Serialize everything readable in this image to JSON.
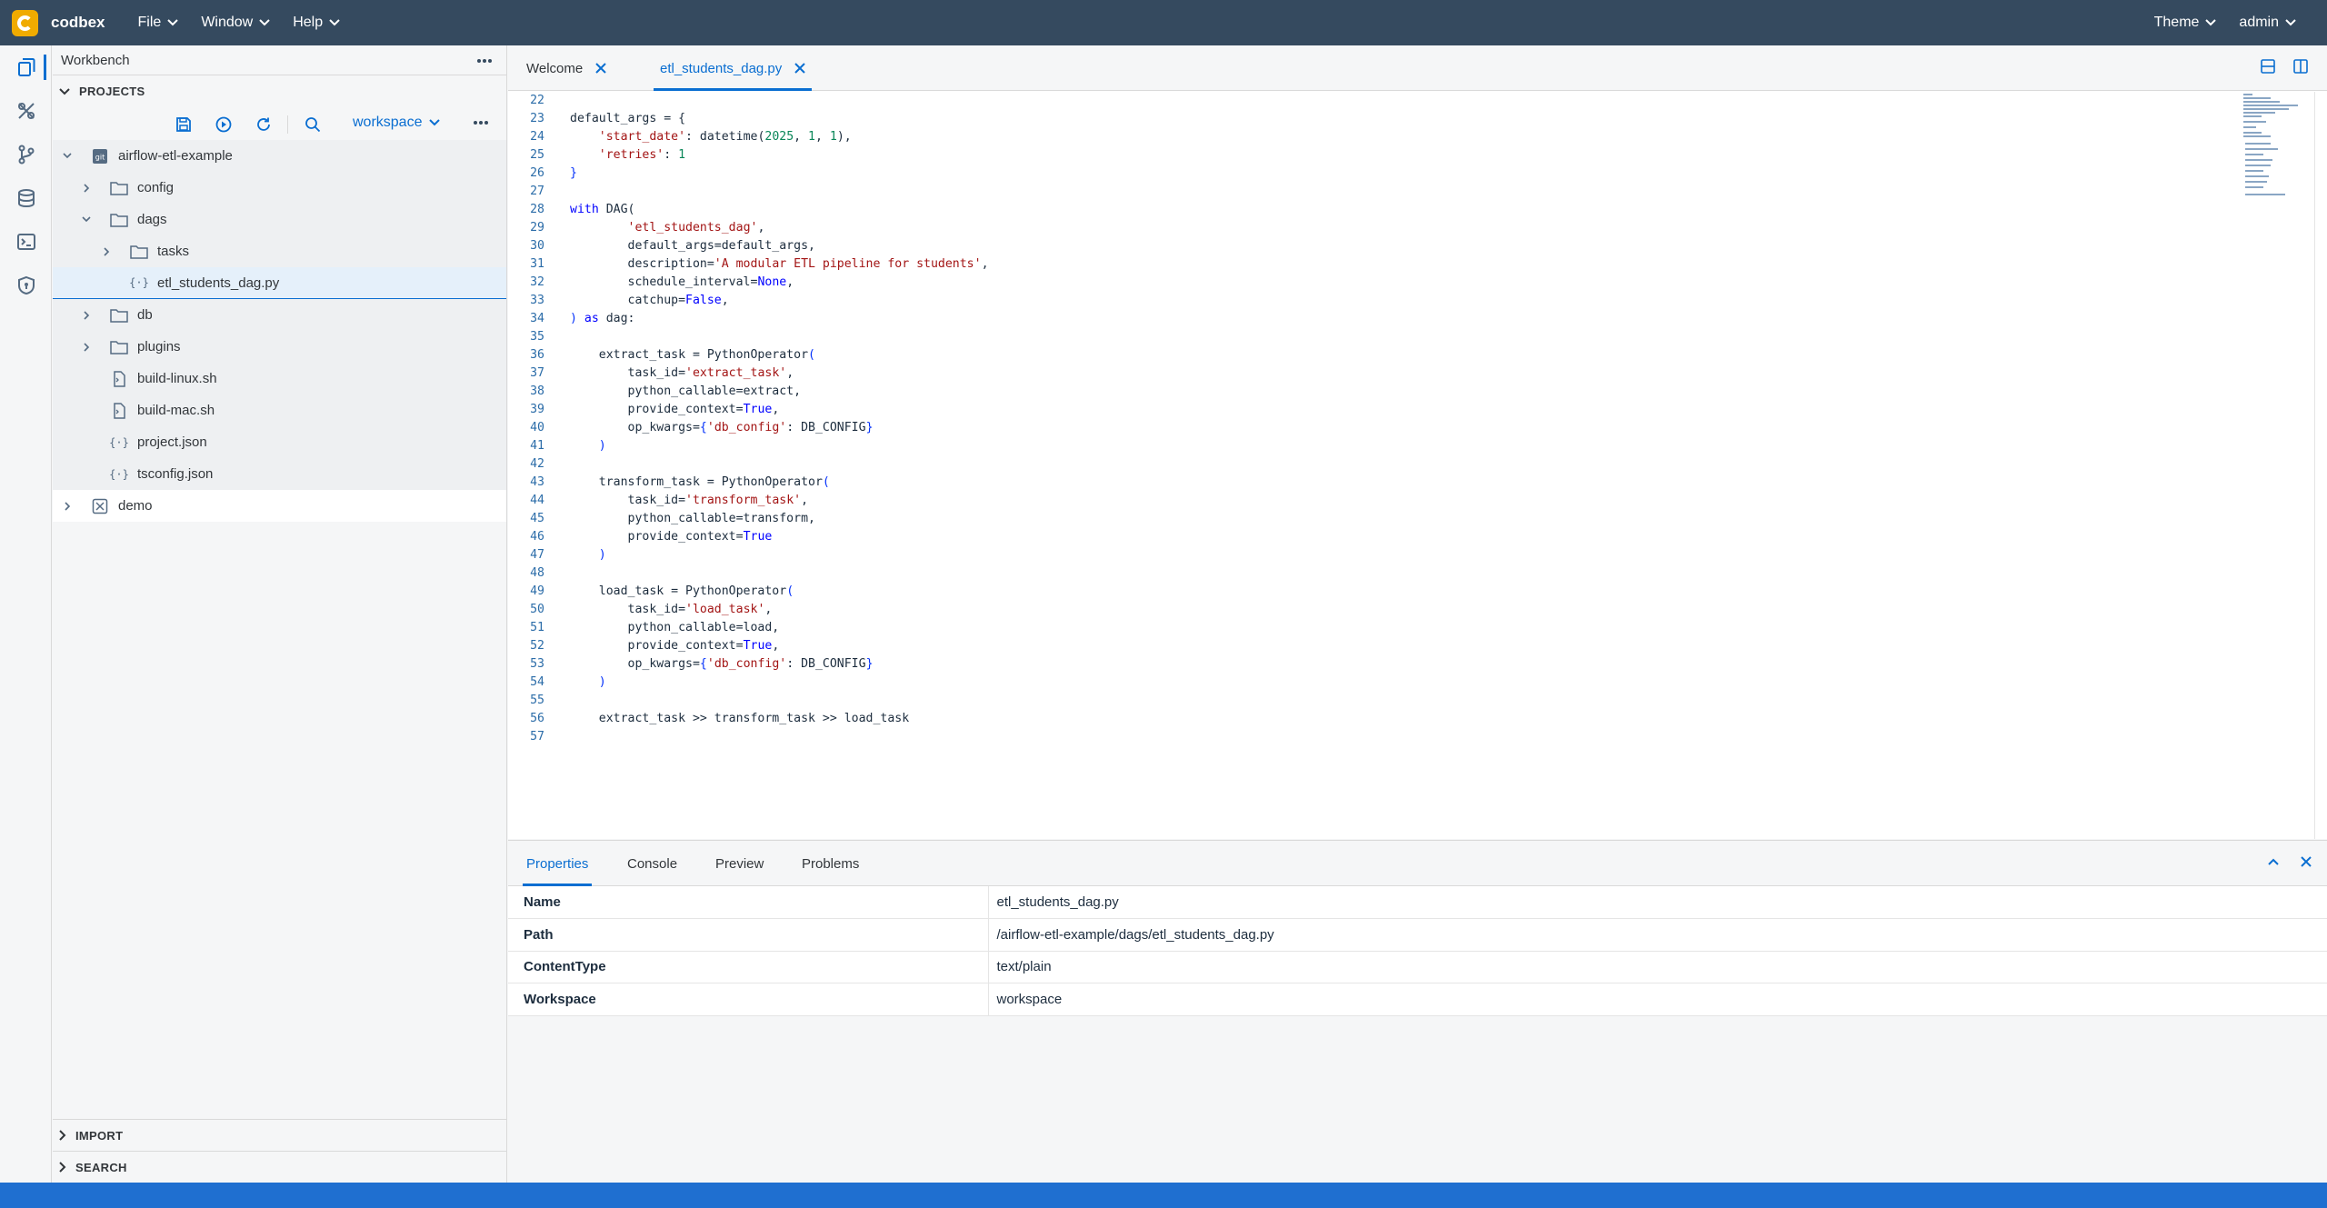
{
  "shell": {
    "brand": "codbex",
    "menus": [
      "File",
      "Window",
      "Help"
    ],
    "theme_label": "Theme",
    "user_label": "admin"
  },
  "activity_bar": {
    "items": [
      "workbench-icon",
      "integrations-icon",
      "git-icon",
      "database-icon",
      "terminal-icon",
      "security-icon"
    ]
  },
  "sidebar": {
    "title": "Workbench",
    "projects_label": "PROJECTS",
    "workspace_label": "workspace",
    "import_label": "IMPORT",
    "search_label": "SEARCH",
    "tree": {
      "project": "airflow-etl-example",
      "config": "config",
      "dags": "dags",
      "tasks": "tasks",
      "dag_file": "etl_students_dag.py",
      "db": "db",
      "plugins": "plugins",
      "build_linux": "build-linux.sh",
      "build_mac": "build-mac.sh",
      "project_json": "project.json",
      "tsconfig": "tsconfig.json",
      "demo": "demo"
    }
  },
  "editor": {
    "tabs": [
      {
        "label": "Welcome"
      },
      {
        "label": "etl_students_dag.py"
      }
    ],
    "line_numbers": [
      "22",
      "23",
      "24",
      "25",
      "26",
      "27",
      "28",
      "29",
      "30",
      "31",
      "32",
      "33",
      "34",
      "35",
      "36",
      "37",
      "38",
      "39",
      "40",
      "41",
      "42",
      "43",
      "44",
      "45",
      "46",
      "47",
      "48",
      "49",
      "50",
      "51",
      "52",
      "53",
      "54",
      "55",
      "56",
      "57"
    ]
  },
  "panel": {
    "tabs": [
      "Properties",
      "Console",
      "Preview",
      "Problems"
    ],
    "properties": [
      {
        "key": "Name",
        "value": "etl_students_dag.py"
      },
      {
        "key": "Path",
        "value": "/airflow-etl-example/dags/etl_students_dag.py"
      },
      {
        "key": "ContentType",
        "value": "text/plain"
      },
      {
        "key": "Workspace",
        "value": "workspace"
      }
    ]
  },
  "colors": {
    "shell_bg": "#354a5f",
    "accent": "#0a6ed1",
    "status_bar": "#1f6fd0",
    "logo": "#f0ab00"
  }
}
